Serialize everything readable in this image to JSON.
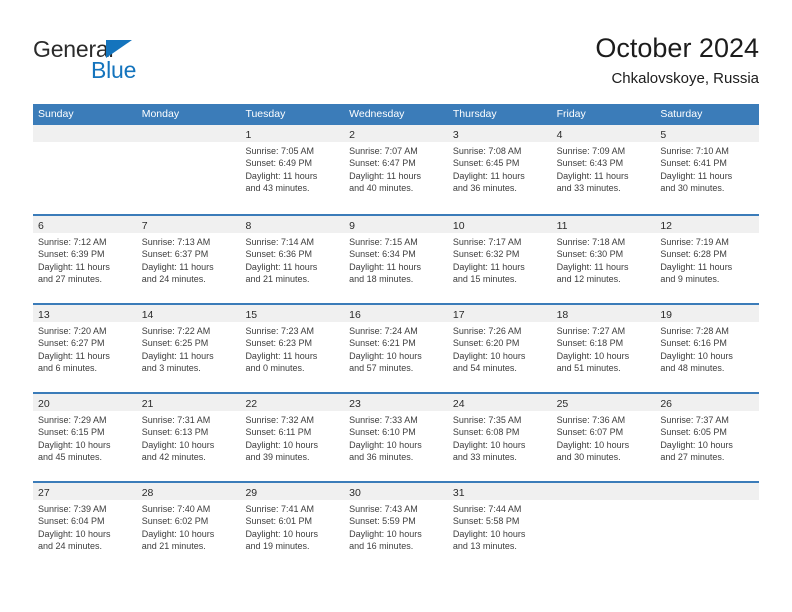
{
  "brand": {
    "name_part1": "General",
    "name_part2": "Blue",
    "triangle_color": "#1474bd"
  },
  "title": {
    "month_year": "October 2024",
    "location": "Chkalovskoye, Russia"
  },
  "theme": {
    "header_blue": "#3b7cb9",
    "day_band_gray": "#f0f0f0",
    "text_dark": "#2b2b2b"
  },
  "weekdays": [
    "Sunday",
    "Monday",
    "Tuesday",
    "Wednesday",
    "Thursday",
    "Friday",
    "Saturday"
  ],
  "weeks": [
    [
      {
        "day": "",
        "empty": true
      },
      {
        "day": "",
        "empty": true
      },
      {
        "day": "1",
        "sunrise": "Sunrise: 7:05 AM",
        "sunset": "Sunset: 6:49 PM",
        "daylight1": "Daylight: 11 hours",
        "daylight2": "and 43 minutes."
      },
      {
        "day": "2",
        "sunrise": "Sunrise: 7:07 AM",
        "sunset": "Sunset: 6:47 PM",
        "daylight1": "Daylight: 11 hours",
        "daylight2": "and 40 minutes."
      },
      {
        "day": "3",
        "sunrise": "Sunrise: 7:08 AM",
        "sunset": "Sunset: 6:45 PM",
        "daylight1": "Daylight: 11 hours",
        "daylight2": "and 36 minutes."
      },
      {
        "day": "4",
        "sunrise": "Sunrise: 7:09 AM",
        "sunset": "Sunset: 6:43 PM",
        "daylight1": "Daylight: 11 hours",
        "daylight2": "and 33 minutes."
      },
      {
        "day": "5",
        "sunrise": "Sunrise: 7:10 AM",
        "sunset": "Sunset: 6:41 PM",
        "daylight1": "Daylight: 11 hours",
        "daylight2": "and 30 minutes."
      }
    ],
    [
      {
        "day": "6",
        "sunrise": "Sunrise: 7:12 AM",
        "sunset": "Sunset: 6:39 PM",
        "daylight1": "Daylight: 11 hours",
        "daylight2": "and 27 minutes."
      },
      {
        "day": "7",
        "sunrise": "Sunrise: 7:13 AM",
        "sunset": "Sunset: 6:37 PM",
        "daylight1": "Daylight: 11 hours",
        "daylight2": "and 24 minutes."
      },
      {
        "day": "8",
        "sunrise": "Sunrise: 7:14 AM",
        "sunset": "Sunset: 6:36 PM",
        "daylight1": "Daylight: 11 hours",
        "daylight2": "and 21 minutes."
      },
      {
        "day": "9",
        "sunrise": "Sunrise: 7:15 AM",
        "sunset": "Sunset: 6:34 PM",
        "daylight1": "Daylight: 11 hours",
        "daylight2": "and 18 minutes."
      },
      {
        "day": "10",
        "sunrise": "Sunrise: 7:17 AM",
        "sunset": "Sunset: 6:32 PM",
        "daylight1": "Daylight: 11 hours",
        "daylight2": "and 15 minutes."
      },
      {
        "day": "11",
        "sunrise": "Sunrise: 7:18 AM",
        "sunset": "Sunset: 6:30 PM",
        "daylight1": "Daylight: 11 hours",
        "daylight2": "and 12 minutes."
      },
      {
        "day": "12",
        "sunrise": "Sunrise: 7:19 AM",
        "sunset": "Sunset: 6:28 PM",
        "daylight1": "Daylight: 11 hours",
        "daylight2": "and 9 minutes."
      }
    ],
    [
      {
        "day": "13",
        "sunrise": "Sunrise: 7:20 AM",
        "sunset": "Sunset: 6:27 PM",
        "daylight1": "Daylight: 11 hours",
        "daylight2": "and 6 minutes."
      },
      {
        "day": "14",
        "sunrise": "Sunrise: 7:22 AM",
        "sunset": "Sunset: 6:25 PM",
        "daylight1": "Daylight: 11 hours",
        "daylight2": "and 3 minutes."
      },
      {
        "day": "15",
        "sunrise": "Sunrise: 7:23 AM",
        "sunset": "Sunset: 6:23 PM",
        "daylight1": "Daylight: 11 hours",
        "daylight2": "and 0 minutes."
      },
      {
        "day": "16",
        "sunrise": "Sunrise: 7:24 AM",
        "sunset": "Sunset: 6:21 PM",
        "daylight1": "Daylight: 10 hours",
        "daylight2": "and 57 minutes."
      },
      {
        "day": "17",
        "sunrise": "Sunrise: 7:26 AM",
        "sunset": "Sunset: 6:20 PM",
        "daylight1": "Daylight: 10 hours",
        "daylight2": "and 54 minutes."
      },
      {
        "day": "18",
        "sunrise": "Sunrise: 7:27 AM",
        "sunset": "Sunset: 6:18 PM",
        "daylight1": "Daylight: 10 hours",
        "daylight2": "and 51 minutes."
      },
      {
        "day": "19",
        "sunrise": "Sunrise: 7:28 AM",
        "sunset": "Sunset: 6:16 PM",
        "daylight1": "Daylight: 10 hours",
        "daylight2": "and 48 minutes."
      }
    ],
    [
      {
        "day": "20",
        "sunrise": "Sunrise: 7:29 AM",
        "sunset": "Sunset: 6:15 PM",
        "daylight1": "Daylight: 10 hours",
        "daylight2": "and 45 minutes."
      },
      {
        "day": "21",
        "sunrise": "Sunrise: 7:31 AM",
        "sunset": "Sunset: 6:13 PM",
        "daylight1": "Daylight: 10 hours",
        "daylight2": "and 42 minutes."
      },
      {
        "day": "22",
        "sunrise": "Sunrise: 7:32 AM",
        "sunset": "Sunset: 6:11 PM",
        "daylight1": "Daylight: 10 hours",
        "daylight2": "and 39 minutes."
      },
      {
        "day": "23",
        "sunrise": "Sunrise: 7:33 AM",
        "sunset": "Sunset: 6:10 PM",
        "daylight1": "Daylight: 10 hours",
        "daylight2": "and 36 minutes."
      },
      {
        "day": "24",
        "sunrise": "Sunrise: 7:35 AM",
        "sunset": "Sunset: 6:08 PM",
        "daylight1": "Daylight: 10 hours",
        "daylight2": "and 33 minutes."
      },
      {
        "day": "25",
        "sunrise": "Sunrise: 7:36 AM",
        "sunset": "Sunset: 6:07 PM",
        "daylight1": "Daylight: 10 hours",
        "daylight2": "and 30 minutes."
      },
      {
        "day": "26",
        "sunrise": "Sunrise: 7:37 AM",
        "sunset": "Sunset: 6:05 PM",
        "daylight1": "Daylight: 10 hours",
        "daylight2": "and 27 minutes."
      }
    ],
    [
      {
        "day": "27",
        "sunrise": "Sunrise: 7:39 AM",
        "sunset": "Sunset: 6:04 PM",
        "daylight1": "Daylight: 10 hours",
        "daylight2": "and 24 minutes."
      },
      {
        "day": "28",
        "sunrise": "Sunrise: 7:40 AM",
        "sunset": "Sunset: 6:02 PM",
        "daylight1": "Daylight: 10 hours",
        "daylight2": "and 21 minutes."
      },
      {
        "day": "29",
        "sunrise": "Sunrise: 7:41 AM",
        "sunset": "Sunset: 6:01 PM",
        "daylight1": "Daylight: 10 hours",
        "daylight2": "and 19 minutes."
      },
      {
        "day": "30",
        "sunrise": "Sunrise: 7:43 AM",
        "sunset": "Sunset: 5:59 PM",
        "daylight1": "Daylight: 10 hours",
        "daylight2": "and 16 minutes."
      },
      {
        "day": "31",
        "sunrise": "Sunrise: 7:44 AM",
        "sunset": "Sunset: 5:58 PM",
        "daylight1": "Daylight: 10 hours",
        "daylight2": "and 13 minutes."
      },
      {
        "day": "",
        "empty": true
      },
      {
        "day": "",
        "empty": true
      }
    ]
  ]
}
